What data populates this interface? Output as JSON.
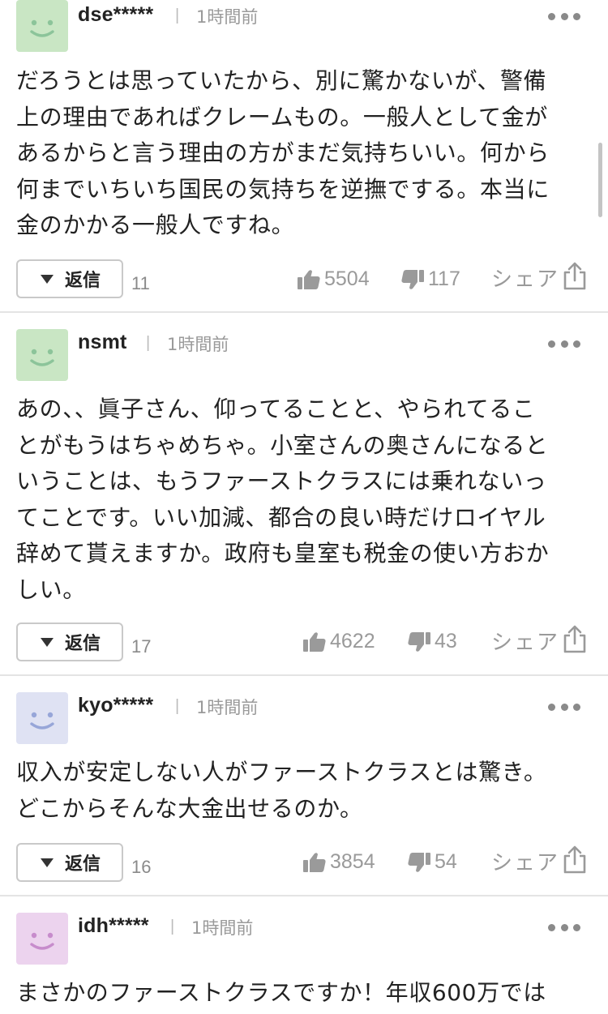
{
  "comments": [
    {
      "username": "dse*****",
      "separator": "|",
      "time": "1時間前",
      "avatar_color": "#c9e6c4",
      "face_color": "#8cc49a",
      "lines": [
        "だろうとは思っていたから、別に驚かないが、警備",
        "上の理由であればクレームもの。一般人として金が",
        "あるからと言う理由の方がまだ気持ちいい。何から",
        "何までいちいち国民の気持ちを逆撫でする。本当に",
        "金のかかる一般人ですね。"
      ],
      "reply_label": "返信",
      "reply_count": "11",
      "likes": "5504",
      "dislikes": "117",
      "share_label": "シェア"
    },
    {
      "username": "nsmt",
      "separator": "|",
      "time": "1時間前",
      "avatar_color": "#c9e6c4",
      "face_color": "#8cc49a",
      "lines": [
        "あの、、眞子さん、仰ってることと、やられてるこ",
        "とがもうはちゃめちゃ。小室さんの奥さんになると",
        "いうことは、もうファーストクラスには乗れないっ",
        "てことです。いい加減、都合の良い時だけロイヤル",
        "辞めて貰えますか。政府も皇室も税金の使い方おか",
        "しい。"
      ],
      "reply_label": "返信",
      "reply_count": "17",
      "likes": "4622",
      "dislikes": "43",
      "share_label": "シェア"
    },
    {
      "username": "kyo*****",
      "separator": "|",
      "time": "1時間前",
      "avatar_color": "#dfe2f3",
      "face_color": "#97a6d8",
      "lines": [
        "収入が安定しない人がファーストクラスとは驚き。",
        "どこからそんな大金出せるのか。"
      ],
      "reply_label": "返信",
      "reply_count": "16",
      "likes": "3854",
      "dislikes": "54",
      "share_label": "シェア"
    },
    {
      "username": "idh*****",
      "separator": "|",
      "time": "1時間前",
      "avatar_color": "#ecd3ee",
      "face_color": "#c78ccc",
      "lines": [
        "まさかのファーストクラスですか！年収600万では"
      ]
    }
  ],
  "icons": {
    "more": "more-dots-icon",
    "like": "thumbs-up-icon",
    "dislike": "thumbs-down-icon",
    "share": "share-icon",
    "reply": "triangle-down-icon"
  },
  "colors": {
    "text": "#222222",
    "meta": "#9a9a9a",
    "divider": "#e4e4e4"
  }
}
